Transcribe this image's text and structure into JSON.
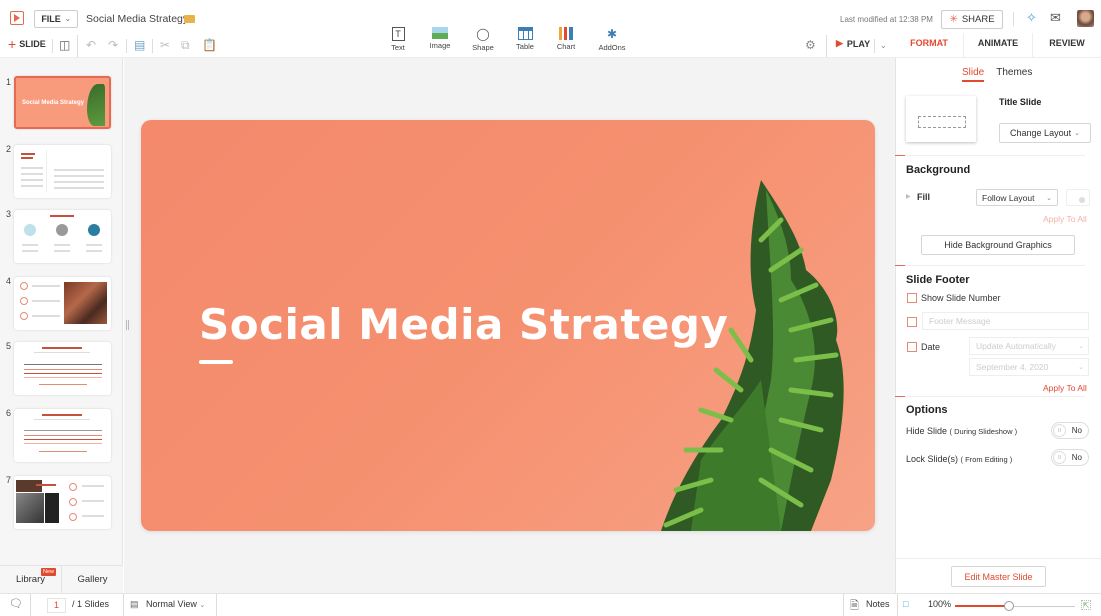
{
  "app": {
    "file_menu": "FILE",
    "doc_title": "Social Media Strategy",
    "last_modified": "Last modified at 12:38 PM",
    "share_label": "SHARE"
  },
  "toolbar": {
    "add_slide": "SLIDE",
    "insert": [
      {
        "label": "Text",
        "icon": "text-box-icon"
      },
      {
        "label": "Image",
        "icon": "image-icon"
      },
      {
        "label": "Shape",
        "icon": "shape-icon"
      },
      {
        "label": "Table",
        "icon": "table-icon"
      },
      {
        "label": "Chart",
        "icon": "chart-icon"
      },
      {
        "label": "AddOns",
        "icon": "puzzle-icon"
      }
    ],
    "play_label": "PLAY"
  },
  "right_tabs": [
    {
      "label": "FORMAT",
      "active": true
    },
    {
      "label": "ANIMATE",
      "active": false
    },
    {
      "label": "REVIEW",
      "active": false
    }
  ],
  "sidebar": {
    "slides": [
      {
        "num": "1",
        "title": "Social Media Strategy"
      },
      {
        "num": "2",
        "title": "Company Overview"
      },
      {
        "num": "3",
        "title": "Meet the team"
      },
      {
        "num": "4",
        "title": ""
      },
      {
        "num": "5",
        "title": "Performance by Platform"
      },
      {
        "num": "6",
        "title": "Performance by Platform"
      },
      {
        "num": "7",
        "title": "Content Skills"
      }
    ],
    "library_label": "Library",
    "new_badge": "New",
    "gallery_label": "Gallery"
  },
  "slide": {
    "title": "Social Media Strategy",
    "bg_color": "#f4896c"
  },
  "format_panel": {
    "subtabs": [
      {
        "label": "Slide",
        "active": true
      },
      {
        "label": "Themes",
        "active": false
      }
    ],
    "layout_name": "Title Slide",
    "change_layout": "Change Layout",
    "background": {
      "title": "Background",
      "fill_label": "Fill",
      "fill_value": "Follow Layout",
      "apply_all": "Apply To All",
      "hide_graphics": "Hide Background Graphics"
    },
    "footer": {
      "title": "Slide Footer",
      "show_number": "Show Slide Number",
      "footer_placeholder": "Footer Message",
      "date_label": "Date",
      "date_mode": "Update Automatically",
      "date_value": "September 4, 2020",
      "apply_all": "Apply To All"
    },
    "options": {
      "title": "Options",
      "hide_slide": "Hide Slide",
      "hide_slide_note": "( During Slideshow )",
      "hide_value": "No",
      "lock_slide": "Lock Slide(s)",
      "lock_slide_note": "( From Editing )",
      "lock_value": "No"
    },
    "edit_master": "Edit Master Slide"
  },
  "status": {
    "current_page": "1",
    "total": "/ 1 Slides",
    "view": "Normal View",
    "notes": "Notes",
    "zoom": "100%",
    "zoom_fraction": 0.45
  },
  "colors": {
    "accent": "#e04a2f"
  }
}
